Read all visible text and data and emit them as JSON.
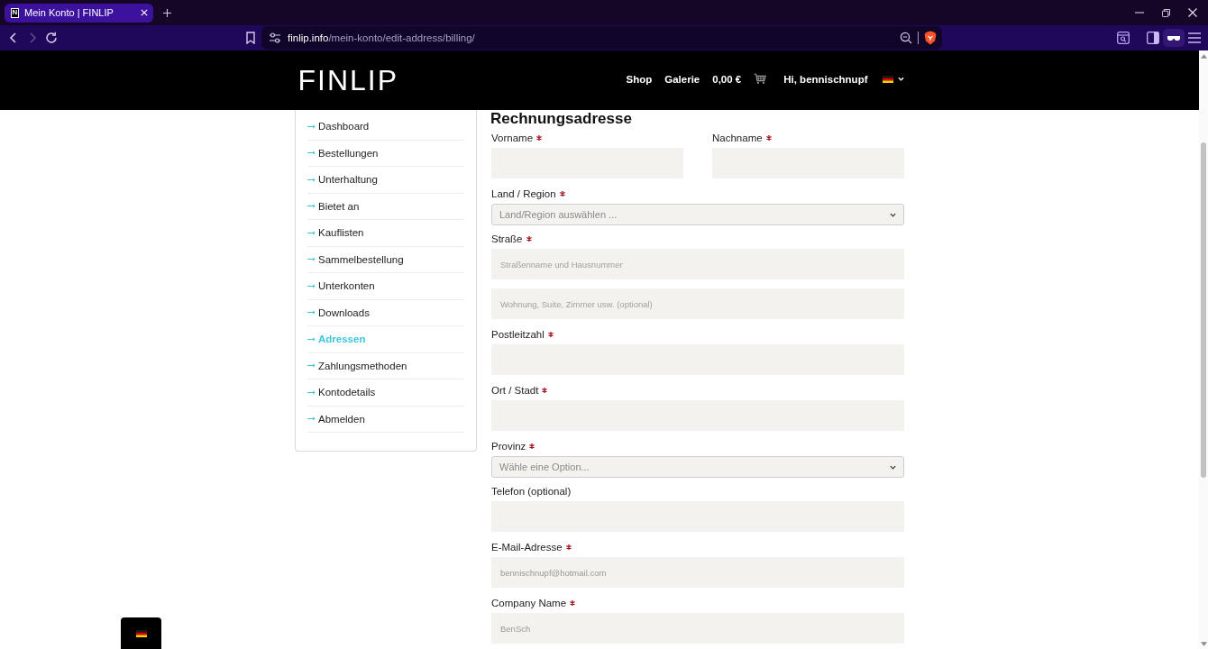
{
  "browser": {
    "tab": {
      "favicon": "N",
      "title": "Mein Konto | FINLIP",
      "selected": true
    },
    "address_bar": {
      "host": "finlip.info",
      "path": "/mein-konto/edit-address/billing/"
    }
  },
  "header": {
    "logo": "FINLIP",
    "nav": [
      "Shop",
      "Galerie"
    ],
    "cart_total": "0,00 €",
    "greeting": "Hi, bennischnupf"
  },
  "sidebar": {
    "items": [
      {
        "label": "Dashboard",
        "selected": false
      },
      {
        "label": "Bestellungen",
        "selected": false
      },
      {
        "label": "Unterhaltung",
        "selected": false
      },
      {
        "label": "Bietet an",
        "selected": false
      },
      {
        "label": "Kauflisten",
        "selected": false
      },
      {
        "label": "Sammelbestellung",
        "selected": false
      },
      {
        "label": "Unterkonten",
        "selected": false
      },
      {
        "label": "Downloads",
        "selected": false
      },
      {
        "label": "Adressen",
        "selected": true
      },
      {
        "label": "Zahlungsmethoden",
        "selected": false
      },
      {
        "label": "Kontodetails",
        "selected": false
      },
      {
        "label": "Abmelden",
        "selected": false
      }
    ]
  },
  "form": {
    "title": "Rechnungsadresse",
    "rows": [
      [
        {
          "kind": "text",
          "label": "Vorname",
          "required": true
        },
        {
          "kind": "text",
          "label": "Nachname",
          "required": true
        }
      ],
      [
        {
          "kind": "select",
          "label": "Land / Region",
          "required": true,
          "placeholder": "Land/Region auswählen ..."
        }
      ],
      [
        {
          "kind": "text",
          "label": "Straße",
          "required": true,
          "placeholder": "Straßenname und Hausnummer"
        }
      ],
      [
        {
          "kind": "text",
          "placeholder": "Wohnung, Suite, Zimmer usw. (optional)"
        }
      ],
      [
        {
          "kind": "text",
          "label": "Postleitzahl",
          "required": true
        }
      ],
      [
        {
          "kind": "text",
          "label": "Ort / Stadt",
          "required": true
        }
      ],
      [
        {
          "kind": "select",
          "label": "Provinz",
          "required": true,
          "placeholder": "Wähle eine Option..."
        }
      ],
      [
        {
          "kind": "text",
          "label": "Telefon (optional)",
          "required": false
        }
      ],
      [
        {
          "kind": "text",
          "label": "E-Mail-Adresse",
          "required": true,
          "value": "bennischnupf@hotmail.com"
        }
      ],
      [
        {
          "kind": "text",
          "label": "Company Name",
          "required": true,
          "value": "BenSch"
        }
      ]
    ]
  }
}
